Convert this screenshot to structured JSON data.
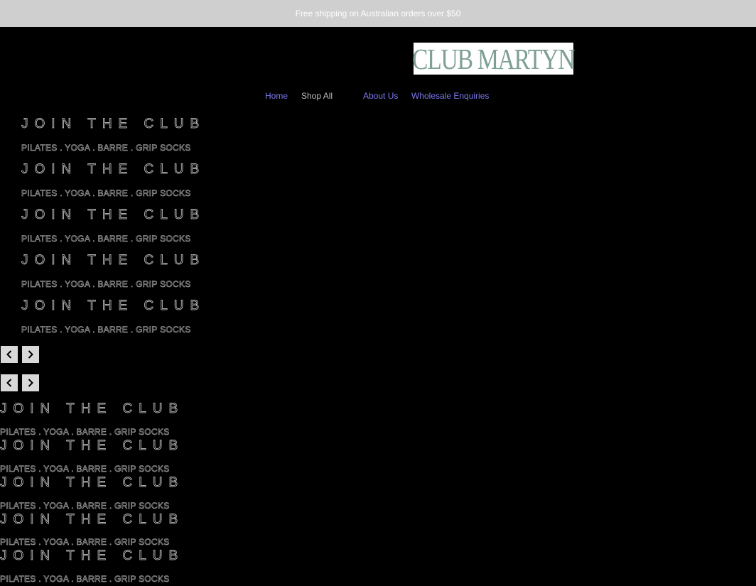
{
  "announcement": {
    "text": "Free shipping on Australian orders over $50"
  },
  "brand": {
    "logo_text": "CLUB MARTYN",
    "logo_color": "#7f9f95"
  },
  "nav": {
    "items": [
      {
        "label": "Home"
      },
      {
        "label": "Shop All"
      },
      {
        "label": "About Us"
      },
      {
        "label": "Wholesale Enquiries"
      }
    ]
  },
  "slides_primary": [
    {
      "title": "JOIN THE CLUB",
      "tagline": "PILATES . YOGA . BARRE . GRIP SOCKS"
    },
    {
      "title": "JOIN THE CLUB",
      "tagline": "PILATES . YOGA . BARRE . GRIP SOCKS"
    },
    {
      "title": "JOIN THE CLUB",
      "tagline": "PILATES . YOGA . BARRE . GRIP SOCKS"
    },
    {
      "title": "JOIN THE CLUB",
      "tagline": "PILATES . YOGA . BARRE . GRIP SOCKS"
    },
    {
      "title": "JOIN THE CLUB",
      "tagline": "PILATES . YOGA . BARRE . GRIP SOCKS"
    }
  ],
  "slides_secondary": [
    {
      "title": "JOIN THE CLUB",
      "tagline": "PILATES . YOGA . BARRE . GRIP SOCKS"
    },
    {
      "title": "JOIN THE CLUB",
      "tagline": "PILATES . YOGA . BARRE . GRIP SOCKS"
    },
    {
      "title": "JOIN THE CLUB",
      "tagline": "PILATES . YOGA . BARRE . GRIP SOCKS"
    },
    {
      "title": "JOIN THE CLUB",
      "tagline": "PILATES . YOGA . BARRE . GRIP SOCKS"
    },
    {
      "title": "JOIN THE CLUB",
      "tagline": "PILATES . YOGA . BARRE . GRIP SOCKS"
    }
  ],
  "carousel_controls": {
    "prev_icon": "chevron-left-icon",
    "next_icon": "chevron-right-icon"
  }
}
